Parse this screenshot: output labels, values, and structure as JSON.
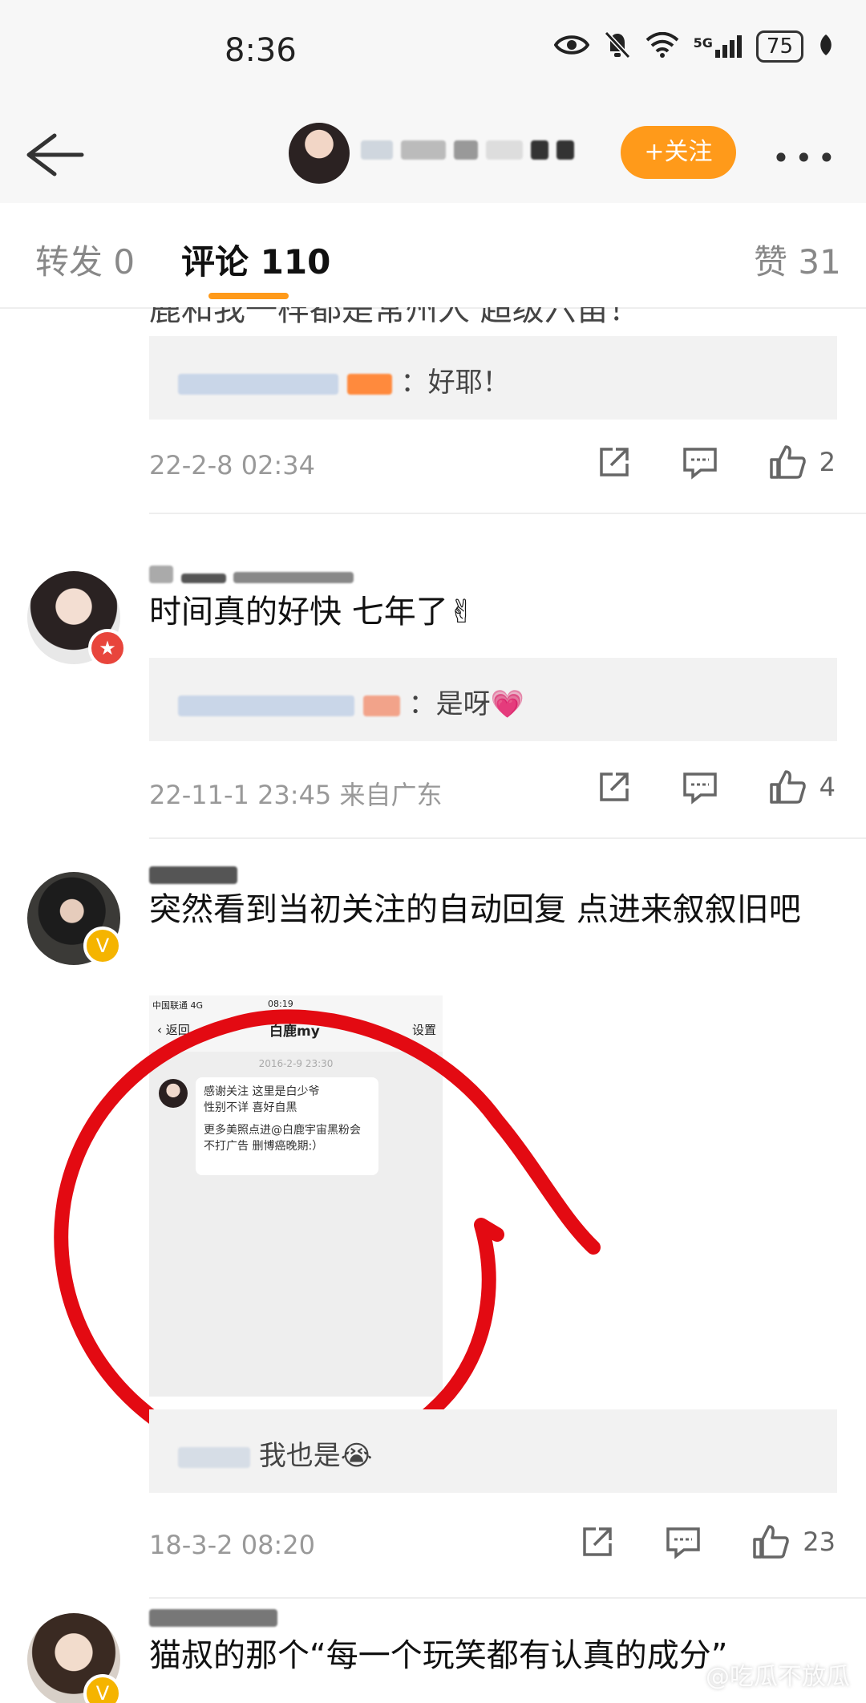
{
  "status_bar": {
    "time": "8:36",
    "network": "5G",
    "battery": "75"
  },
  "header": {
    "follow_label": "+关注"
  },
  "tabs": {
    "repost": "转发 0",
    "comments": "评论 110",
    "likes": "赞 31"
  },
  "comments": [
    {
      "text_partial": "鹿和我一样都是常州人 超级六笛！",
      "reply": {
        "text": "：好耶！"
      },
      "time": "22-2-8 02:34",
      "likes": "2"
    },
    {
      "text": "时间真的好快 七年了✌",
      "reply": {
        "text": "：是呀💗"
      },
      "time": "22-11-1 23:45 来自广东",
      "likes": "4"
    },
    {
      "text": "突然看到当初关注的自动回复 点进来叙叙旧吧",
      "embedded_screenshot": {
        "carrier": "中国联通 4G",
        "time": "08:19",
        "back": "返回",
        "title": "白鹿my",
        "settings": "设置",
        "date": "2016-2-9 23:30",
        "message_line1": "感谢关注 这里是白少爷",
        "message_line2": "性别不详 喜好自黑",
        "message_line3": "更多美照点进@白鹿宇宙黑粉会",
        "message_line4": "不打广告 删博癌晚期:）"
      },
      "reply": {
        "text": "我也是😭"
      },
      "time": "18-3-2 08:20",
      "likes": "23"
    },
    {
      "text": "猫叔的那个“每一个玩笑都有认真的成分”"
    }
  ],
  "watermark": "@吃瓜不放瓜",
  "colors": {
    "accent": "#ff9a1a",
    "reply_name": "#5b83b6",
    "annotation": "#e30a12"
  }
}
